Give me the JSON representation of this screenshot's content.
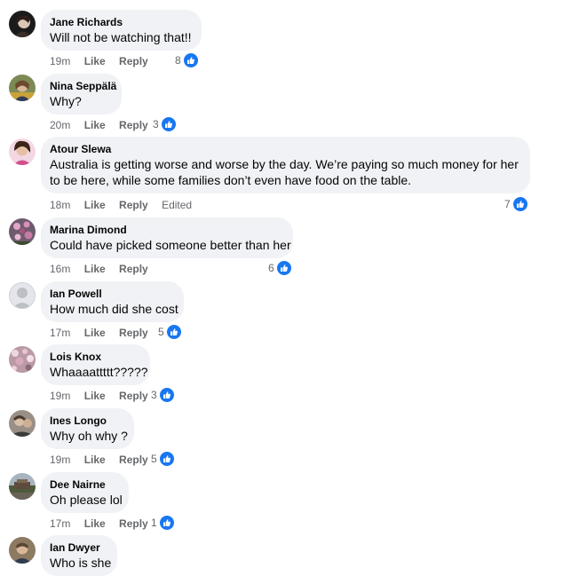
{
  "like_label": "Like",
  "reply_label": "Reply",
  "colors": {
    "bubble": "#f0f2f5",
    "meta_text": "#65676b",
    "like_blue": "#1877f2"
  },
  "icons": {
    "reaction": "thumbs-up-icon"
  },
  "top_partial": {
    "time": "19m",
    "like": "Like",
    "reply": "Reply"
  },
  "comments": [
    {
      "author": "Jane Richards",
      "text": "Will not be watching that!!",
      "time": "19m",
      "reactions": "8"
    },
    {
      "author": "Nina Seppälä",
      "text": "Why?",
      "time": "20m",
      "reactions": "3"
    },
    {
      "author": "Atour Slewa",
      "text": "Australia is getting worse and worse by the day. We’re paying so much money for her to be here, while some families don’t even have food on the table.",
      "time": "18m",
      "edited": "Edited",
      "reactions": "7"
    },
    {
      "author": "Marina Dimond",
      "text": "Could have picked someone better than her",
      "time": "16m",
      "reactions": "6"
    },
    {
      "author": "Ian Powell",
      "text": "How much did she cost",
      "time": "17m",
      "reactions": "5"
    },
    {
      "author": "Lois Knox",
      "text": "Whaaaattttt?????",
      "time": "19m",
      "reactions": "3"
    },
    {
      "author": "Ines Longo",
      "text": "Why oh why ?",
      "time": "19m",
      "reactions": "5"
    },
    {
      "author": "Dee Nairne",
      "text": "Oh please lol",
      "time": "17m",
      "reactions": "1"
    },
    {
      "author": "Ian Dwyer",
      "text": "Who is she",
      "time": "",
      "reactions": ""
    }
  ]
}
